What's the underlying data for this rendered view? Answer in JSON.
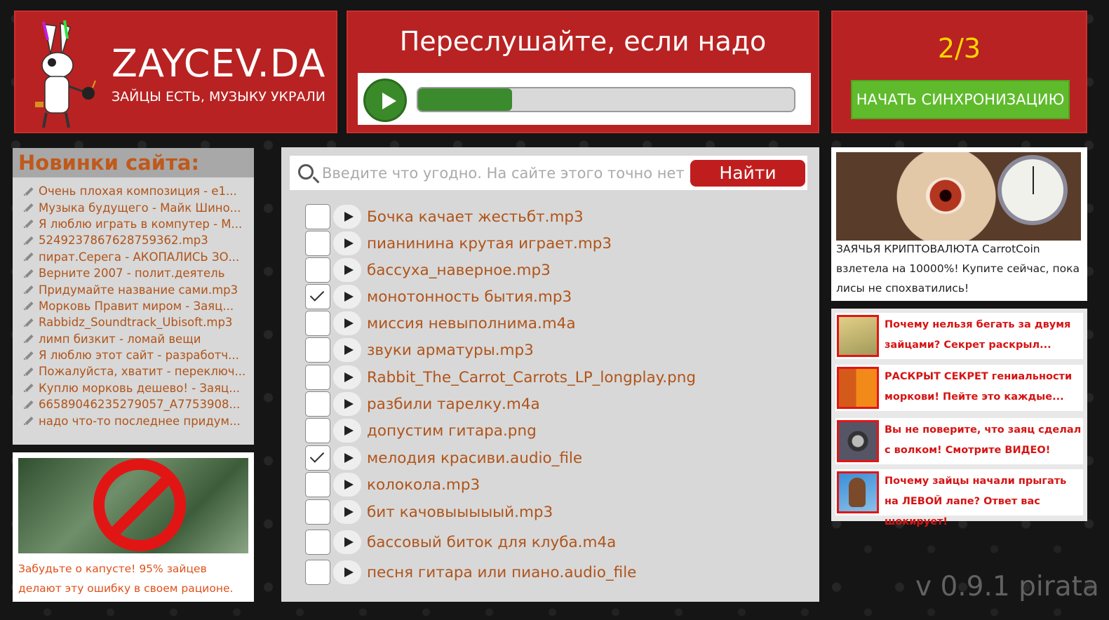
{
  "logo": {
    "brand": "ZAYCEV.DA",
    "tagline": "ЗАЙЦЫ ЕСТЬ, МУЗЫКУ УКРАЛИ"
  },
  "player": {
    "title": "Переслушайте, если надо",
    "progress_percent": 25
  },
  "sync": {
    "count": "2/3",
    "button_label": "НАЧАТЬ СИНХРОНИЗАЦИЮ"
  },
  "news": {
    "heading": "Новинки сайта:",
    "items": [
      "Очень плохая композиция - e1...",
      "Музыка будущего - Майк Шино...",
      "Я люблю играть в компутер - М...",
      "5249237867628759362.mp3",
      "пират.Серега - АКОПАЛИСЬ ЗО...",
      "Верните 2007 - полит.деятель",
      "Придумайте название сами.mp3",
      "Морковь Правит миром - Заяц...",
      "Rabbidz_Soundtrack_Ubisoft.mp3",
      "лимп бизкит - ломай вещи",
      "Я люблю этот сайт - разработч...",
      "Пожалуйста, хватит - переключ...",
      "Куплю морковь дешево! - Заяц...",
      "66589046235279057_A7753908...",
      "надо что-то последнее придум..."
    ]
  },
  "ad_left": {
    "text": "Забудьте о капусте! 95% зайцев делают эту ошибку в своем рационе."
  },
  "search": {
    "placeholder": "Введите что угодно. На сайте этого точно нет",
    "button_label": "Найти"
  },
  "files": [
    {
      "name": "Бочка качает жестьбт.mp3",
      "checked": false
    },
    {
      "name": "пианинина крутая играет.mp3",
      "checked": false
    },
    {
      "name": "бассуха_наверное.mp3",
      "checked": false
    },
    {
      "name": "монотонность бытия.mp3",
      "checked": true
    },
    {
      "name": "миссия невыполнима.m4a",
      "checked": false
    },
    {
      "name": "звуки арматуры.mp3",
      "checked": false
    },
    {
      "name": "Rabbit_The_Carrot_Carrots_LP_longplay.png",
      "checked": false
    },
    {
      "name": "разбили тарелку.m4a",
      "checked": false
    },
    {
      "name": "допустим гитара.png",
      "checked": false
    },
    {
      "name": "мелодия красиви.audio_file",
      "checked": true
    },
    {
      "name": "колокола.mp3",
      "checked": false
    },
    {
      "name": "бит качовыыыыый.mp3",
      "checked": false
    },
    {
      "name": "бассовый биток для клуба.m4a",
      "checked": false
    },
    {
      "name": "песня гитара или пиано.audio_file",
      "checked": false
    }
  ],
  "ad_top": {
    "text": "ЗАЯЧЬЯ КРИПТОВАЛЮТА CarrotCoin взлетела на 10000%! Купите сейчас, пока лисы не спохватились!"
  },
  "ad_list": [
    "Почему нельзя бегать за двумя зайцами? Секрет раскрыл...",
    "РАСКРЫТ СЕКРЕТ гениальности моркови! Пейте это каждые...",
    "Вы не поверите, что заяц сделал с волком! Смотрите ВИДЕО!",
    "Почему зайцы начали прыгать на ЛЕВОЙ лапе? Ответ вас шокирует!"
  ],
  "version": "v 0.9.1 pirata",
  "colors": {
    "brand_red": "#b82222",
    "accent_green": "#5fbb2c",
    "count_yellow": "#ffd800",
    "text_orange": "#b0541a"
  }
}
